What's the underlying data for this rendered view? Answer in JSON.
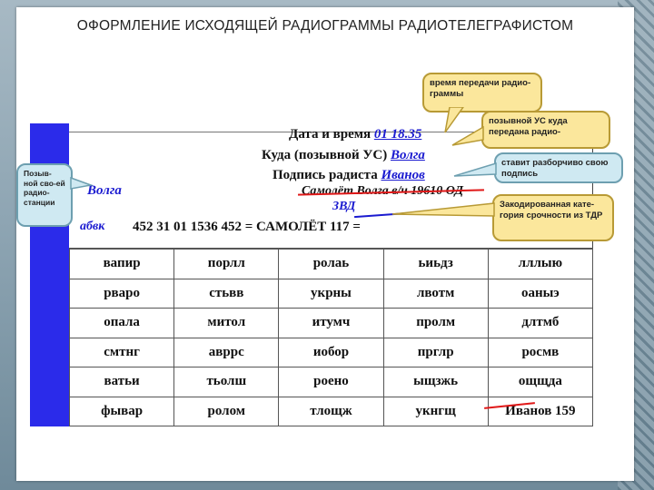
{
  "title": "ОФОРМЛЕНИЕ ИСХОДЯЩЕЙ РАДИОГРАММЫ РАДИОТЕЛЕГРАФИСТОМ",
  "header": {
    "datetime_label": "Дата и время",
    "datetime_value": "01 18.35",
    "to_label": "Куда (позывной УС)",
    "to_value": "Волга",
    "sign_label": "Подпись радиста",
    "sign_value": "Иванов",
    "own_callsign": "Волга",
    "struck_text": "Самолёт Волга в/ч 19610   ОД",
    "category_code": "ЗВД",
    "callsign_line": "абвк",
    "service_line": "452   31   01   1536   452  =  САМОЛЁТ  117  ="
  },
  "table": {
    "rows": [
      [
        "вапир",
        "порлл",
        "ролаь",
        "ьиьдз",
        "лллыю"
      ],
      [
        "рваро",
        "стьвв",
        "укрны",
        "лвотм",
        "оаныэ"
      ],
      [
        "опала",
        "митол",
        "итумч",
        "пролм",
        "длтмб"
      ],
      [
        "смтнг",
        "авррс",
        "иобор",
        "прглр",
        "росмв"
      ],
      [
        "ватьи",
        "тьолш",
        "роено",
        "ыщзжь",
        "ощщда"
      ],
      [
        "фывар",
        "ролом",
        "тлощж",
        "укнгщ",
        "Иванов 159"
      ]
    ]
  },
  "callouts": {
    "time": "время передачи радио-граммы",
    "callsign_us": "позывной УС куда передана радио-",
    "signature": "ставит разборчиво свою подпись",
    "own_station": "Позыв-ной сво-ей радио-станции",
    "category": "Закодированная кате-гория срочности из ТДР"
  }
}
